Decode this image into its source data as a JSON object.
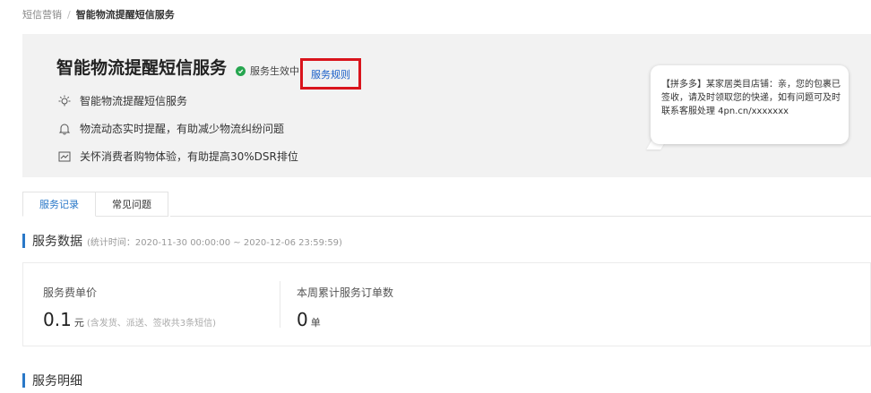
{
  "breadcrumb": {
    "parent": "短信营销",
    "separator": "/",
    "current": "智能物流提醒短信服务"
  },
  "hero": {
    "title": "智能物流提醒短信服务",
    "status_text": "服务生效中",
    "rules_link": "服务规则",
    "features": [
      {
        "icon": "lightbulb-icon",
        "text": "智能物流提醒短信服务"
      },
      {
        "icon": "bell-icon",
        "text": "物流动态实时提醒，有助减少物流纠纷问题"
      },
      {
        "icon": "chart-icon",
        "text": "关怀消费者购物体验，有助提高30%DSR排位"
      }
    ],
    "sms_preview": "【拼多多】某家居类目店铺：亲，您的包裹已签收，请及时领取您的快递，如有问题可及时联系客服处理 4pn.cn/xxxxxxx"
  },
  "tabs": [
    {
      "label": "服务记录",
      "active": true
    },
    {
      "label": "常见问题",
      "active": false
    }
  ],
  "service_data": {
    "title": "服务数据",
    "period_note": "(统计时间：2020-11-30 00:00:00 ~ 2020-12-06 23:59:59)",
    "unit_price": {
      "label": "服务费单价",
      "value": "0.1",
      "unit": "元",
      "note": "(含发货、派送、签收共3条短信)"
    },
    "weekly_orders": {
      "label": "本周累计服务订单数",
      "value": "0",
      "unit": "单"
    }
  },
  "service_detail": {
    "title": "服务明细"
  },
  "colors": {
    "accent": "#2a78c8",
    "status_green": "#27a650",
    "highlight_red": "#d9141c",
    "link_blue": "#1a5fc8"
  }
}
